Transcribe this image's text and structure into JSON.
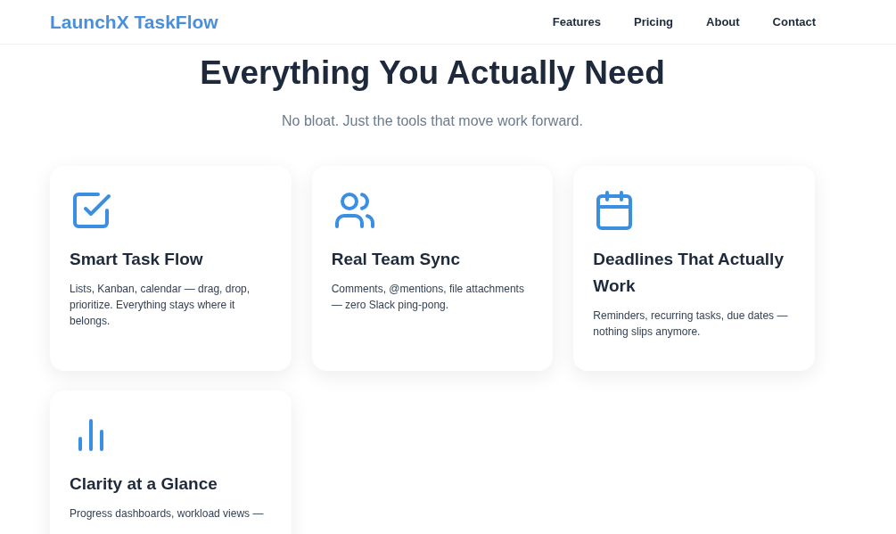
{
  "brand": "LaunchX TaskFlow",
  "nav": [
    "Features",
    "Pricing",
    "About",
    "Contact"
  ],
  "heading": "Everything You Actually Need",
  "subheading": "No bloat. Just the tools that move work forward.",
  "features": [
    {
      "kind": "checklist",
      "title": "Smart Task Flow",
      "text": "Lists, Kanban, calendar — drag, drop, prioritize. Everything stays where it belongs."
    },
    {
      "kind": "team",
      "title": "Real Team Sync",
      "text": "Comments, @mentions, file attachments — zero Slack ping-pong."
    },
    {
      "kind": "calendar",
      "title": "Deadlines That Actually Work",
      "text": "Reminders, recurring tasks, due dates — nothing slips anymore."
    },
    {
      "kind": "chart",
      "title": "Clarity at a Glance",
      "text": "Progress dashboards, workload views —"
    }
  ]
}
